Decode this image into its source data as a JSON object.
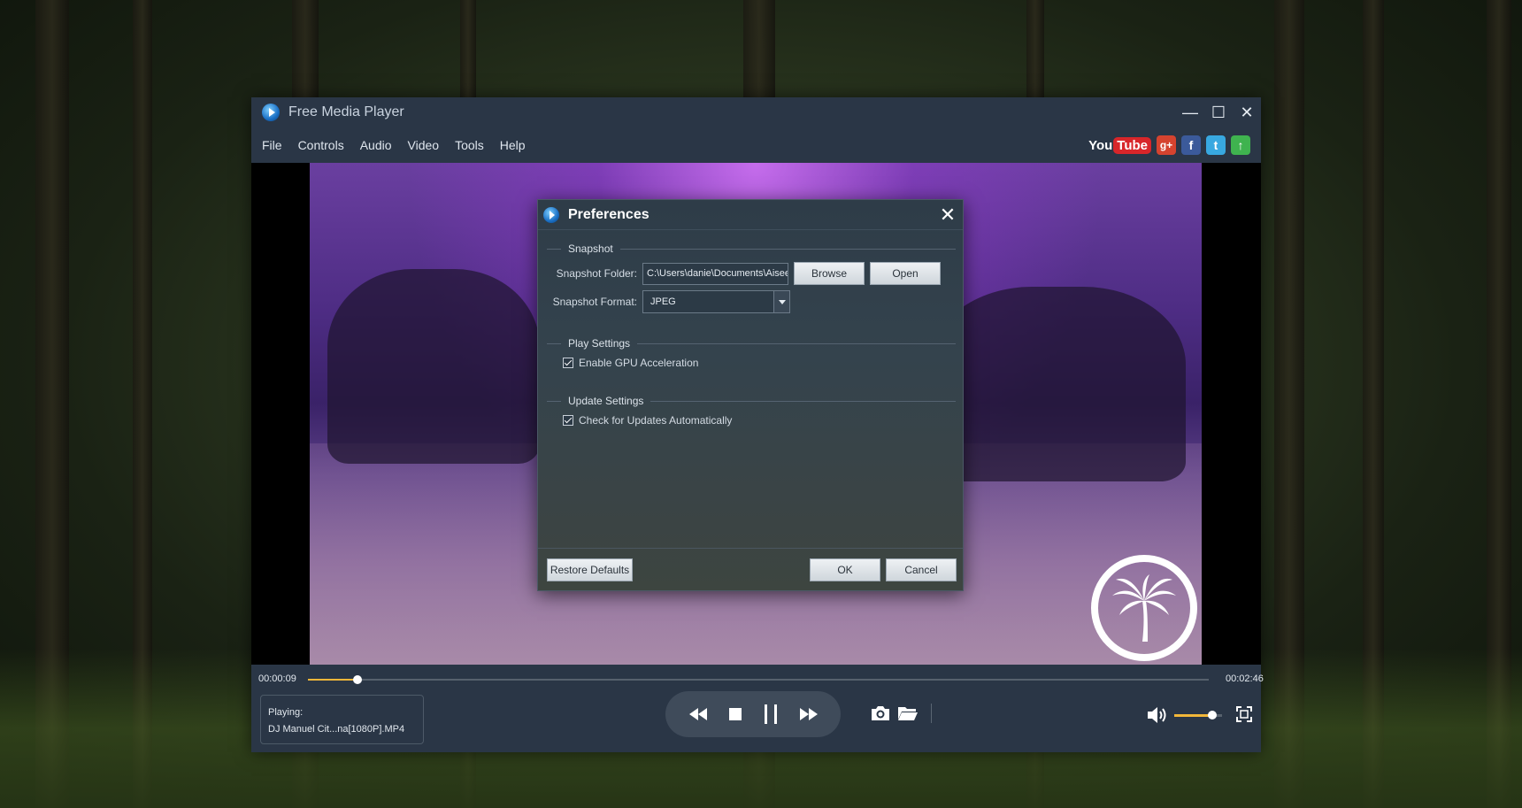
{
  "window": {
    "title": "Free Media Player",
    "controls": {
      "minimize": "—",
      "maximize": "☐",
      "close": "✕"
    }
  },
  "menu": {
    "items": [
      {
        "label": "File"
      },
      {
        "label": "Controls"
      },
      {
        "label": "Audio"
      },
      {
        "label": "Video"
      },
      {
        "label": "Tools"
      },
      {
        "label": "Help"
      }
    ]
  },
  "social": {
    "youtube_you": "You",
    "youtube_tube": "Tube",
    "googleplus": "g+",
    "facebook": "f",
    "twitter": "t",
    "upload": "↑"
  },
  "preferences": {
    "title": "Preferences",
    "close": "✕",
    "snapshot": {
      "section_title": "Snapshot",
      "folder_label": "Snapshot Folder:",
      "folder_value": "C:\\Users\\danie\\Documents\\Aiseesoft Studio\\Snapshot",
      "browse_button": "Browse",
      "open_button": "Open",
      "format_label": "Snapshot Format:",
      "format_value": "JPEG"
    },
    "play_settings": {
      "section_title": "Play Settings",
      "gpu_label": "Enable GPU Acceleration",
      "gpu_checked": true
    },
    "update_settings": {
      "section_title": "Update Settings",
      "updates_label": "Check for Updates Automatically",
      "updates_checked": true
    },
    "restore_button": "Restore Defaults",
    "ok_button": "OK",
    "cancel_button": "Cancel"
  },
  "player": {
    "current_time": "00:00:09",
    "total_time": "00:02:46",
    "progress_fraction": 0.055,
    "volume_fraction": 0.8,
    "playing_label": "Playing:",
    "file_name": "DJ Manuel Cit...na[1080P].MP4"
  },
  "colors": {
    "accent": "#f2b739",
    "window_bg": "#2a3646"
  }
}
